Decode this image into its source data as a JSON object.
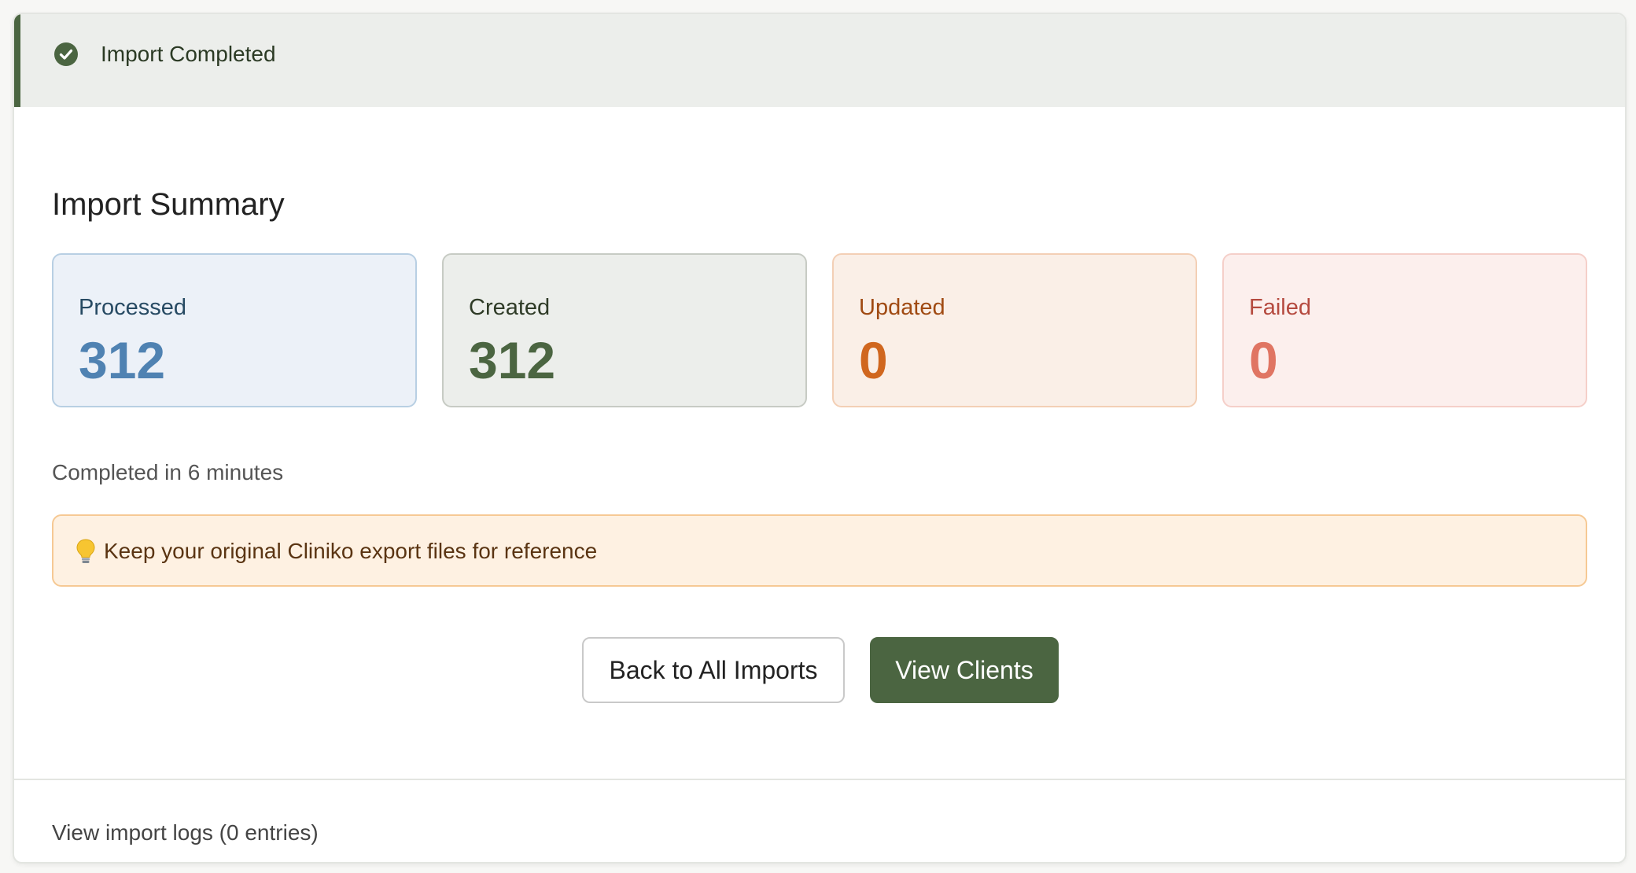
{
  "header": {
    "title": "Import Completed",
    "icon": "check-circle-icon",
    "accent_color": "#4b6541"
  },
  "summary": {
    "title": "Import Summary",
    "stats": [
      {
        "label": "Processed",
        "value": "312",
        "color": "#4f82b2"
      },
      {
        "label": "Created",
        "value": "312",
        "color": "#4b6541"
      },
      {
        "label": "Updated",
        "value": "0",
        "color": "#d0671f"
      },
      {
        "label": "Failed",
        "value": "0",
        "color": "#e07563"
      }
    ],
    "completed_text": "Completed in 6 minutes"
  },
  "tip": {
    "icon": "lightbulb-icon",
    "text": "Keep your original Cliniko export files for reference"
  },
  "actions": {
    "back_label": "Back to All Imports",
    "view_clients_label": "View Clients"
  },
  "footer": {
    "logs_label": "View import logs (0 entries)"
  }
}
